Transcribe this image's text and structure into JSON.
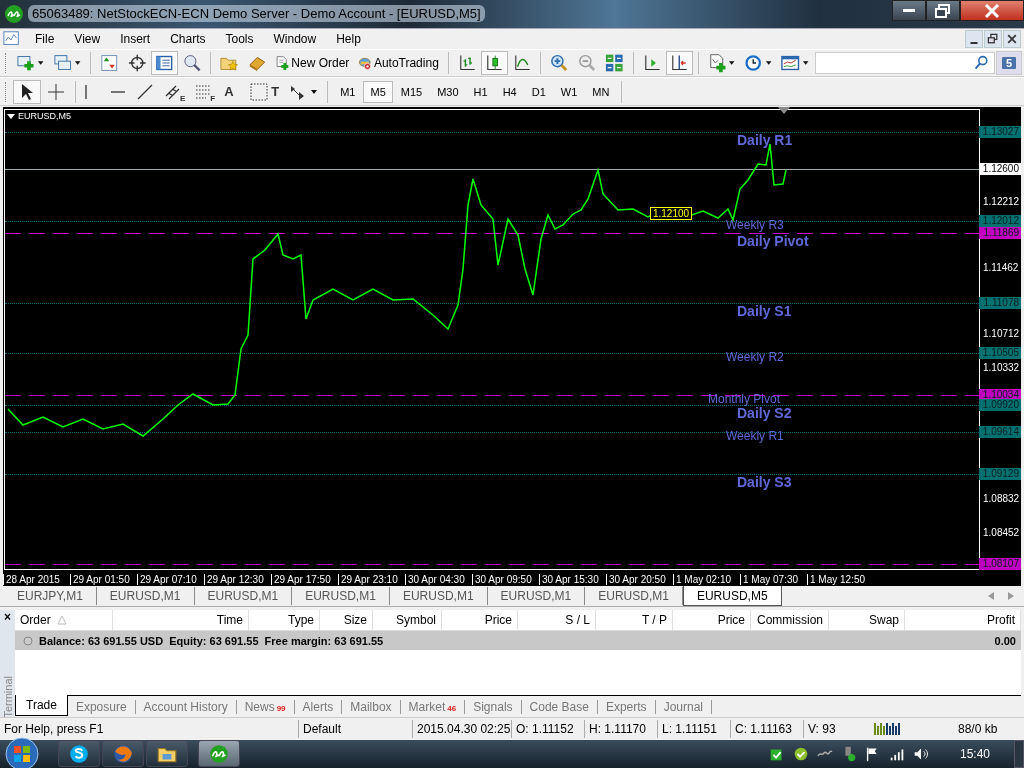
{
  "window": {
    "title": "65063489: NetStockECN-ECN Demo Server - Demo Account - [EURUSD,M5]"
  },
  "menu": [
    {
      "label": "File"
    },
    {
      "label": "View"
    },
    {
      "label": "Insert"
    },
    {
      "label": "Charts"
    },
    {
      "label": "Tools"
    },
    {
      "label": "Window"
    },
    {
      "label": "Help"
    }
  ],
  "toolbar": [
    {
      "kind": "new-chart",
      "dropdown": true,
      "on": false
    },
    {
      "kind": "profiles",
      "dropdown": true,
      "on": false
    },
    {
      "kind": "sep"
    },
    {
      "kind": "market-watch",
      "on": false
    },
    {
      "kind": "navigator",
      "on": false
    },
    {
      "kind": "data-window",
      "on": true
    },
    {
      "kind": "tester",
      "on": false
    },
    {
      "kind": "sep"
    },
    {
      "kind": "favorites",
      "on": false
    },
    {
      "kind": "ingot",
      "on": false
    },
    {
      "kind": "new-order",
      "label": "New Order",
      "on": false
    },
    {
      "kind": "autotrading",
      "label": "AutoTrading",
      "on": false
    },
    {
      "kind": "sep"
    },
    {
      "kind": "bar-chart",
      "on": false
    },
    {
      "kind": "candles",
      "on": true
    },
    {
      "kind": "line-chart",
      "on": false
    },
    {
      "kind": "sep"
    },
    {
      "kind": "zoom-in",
      "on": false
    },
    {
      "kind": "zoom-out",
      "on": false
    },
    {
      "kind": "tile",
      "on": false
    },
    {
      "kind": "sep"
    },
    {
      "kind": "chart-shift",
      "on": false
    },
    {
      "kind": "autoscroll",
      "on": true
    },
    {
      "kind": "sep"
    },
    {
      "kind": "indicators",
      "dropdown": true,
      "on": false
    },
    {
      "kind": "periods",
      "dropdown": true,
      "on": false
    },
    {
      "kind": "templates",
      "dropdown": true,
      "on": false
    }
  ],
  "search": {
    "badge": "5"
  },
  "tools": [
    {
      "kind": "cursor",
      "on": true
    },
    {
      "kind": "crosshair",
      "on": false
    },
    {
      "kind": "sep"
    },
    {
      "kind": "vline",
      "on": false
    },
    {
      "kind": "hline",
      "on": false
    },
    {
      "kind": "trendline",
      "on": false
    },
    {
      "kind": "channel",
      "glyph": "E",
      "on": false
    },
    {
      "kind": "fibo",
      "glyph": "F",
      "on": false
    },
    {
      "kind": "text",
      "glyph": "A",
      "on": false
    },
    {
      "kind": "label",
      "glyph": "T",
      "on": false
    },
    {
      "kind": "arrows",
      "dropdown": true,
      "on": false
    }
  ],
  "periods": [
    {
      "label": "M1",
      "selected": false
    },
    {
      "label": "M5",
      "selected": true
    },
    {
      "label": "M15",
      "selected": false
    },
    {
      "label": "M30",
      "selected": false
    },
    {
      "label": "H1",
      "selected": false
    },
    {
      "label": "H4",
      "selected": false
    },
    {
      "label": "D1",
      "selected": false
    },
    {
      "label": "W1",
      "selected": false
    },
    {
      "label": "MN",
      "selected": false
    }
  ],
  "chart": {
    "title": "EURUSD,M5",
    "current_price": "1.12600",
    "marker": "1.12100",
    "price_ticks": [
      "1.12212",
      "1.11462",
      "1.10712",
      "1.10332",
      "1.08832",
      "1.08452"
    ],
    "levels": [
      {
        "price": "1.13027",
        "kind": "level",
        "color": "#007070",
        "label": "Daily R1",
        "bold": true
      },
      {
        "price": "1.12012",
        "kind": "level",
        "color": "#007070",
        "label": "Weekly R3",
        "bold": false
      },
      {
        "price": "1.11869",
        "kind": "pivot",
        "color": "#c000c0",
        "label": "Daily Pivot",
        "bold": true
      },
      {
        "price": "1.11078",
        "kind": "level",
        "color": "#007070",
        "label": "Daily S1",
        "bold": true
      },
      {
        "price": "1.10505",
        "kind": "level",
        "color": "#007070",
        "label": "Weekly R2",
        "bold": false
      },
      {
        "price": "1.10034",
        "kind": "pivot",
        "color": "#c000c0",
        "label": "Monthly Pivot",
        "bold": false
      },
      {
        "price": "1.09920",
        "kind": "level",
        "color": "#007070",
        "label": "Daily S2",
        "bold": true
      },
      {
        "price": "1.09614",
        "kind": "level",
        "color": "#007070",
        "label": "Weekly R1",
        "bold": false
      },
      {
        "price": "1.09129",
        "kind": "level",
        "color": "#007070",
        "label": "Daily S3",
        "bold": true
      },
      {
        "price": "1.08107",
        "kind": "pivot",
        "color": "#c000c0"
      }
    ],
    "time_labels": [
      "28 Apr 2015",
      "29 Apr 01:50",
      "29 Apr 07:10",
      "29 Apr 12:30",
      "29 Apr 17:50",
      "29 Apr 23:10",
      "30 Apr 04:30",
      "30 Apr 09:50",
      "30 Apr 15:30",
      "30 Apr 20:50",
      "1 May 02:10",
      "1 May 07:30",
      "1 May 12:50"
    ]
  },
  "chart_tabs": [
    {
      "label": "EURJPY,M1",
      "selected": false
    },
    {
      "label": "EURUSD,M1",
      "selected": false
    },
    {
      "label": "EURUSD,M1",
      "selected": false
    },
    {
      "label": "EURUSD,M1",
      "selected": false
    },
    {
      "label": "EURUSD,M1",
      "selected": false
    },
    {
      "label": "EURUSD,M1",
      "selected": false
    },
    {
      "label": "EURUSD,M1",
      "selected": false
    },
    {
      "label": "EURUSD,M5",
      "selected": true
    }
  ],
  "terminal": {
    "close": "×",
    "title": "Terminal",
    "columns": [
      {
        "label": "Order"
      },
      {
        "label": "Time"
      },
      {
        "label": "Type"
      },
      {
        "label": "Size"
      },
      {
        "label": "Symbol"
      },
      {
        "label": "Price"
      },
      {
        "label": "S / L"
      },
      {
        "label": "T / P"
      },
      {
        "label": "Price"
      },
      {
        "label": "Commission"
      },
      {
        "label": "Swap"
      },
      {
        "label": "Profit"
      }
    ],
    "balance": "Balance: 63 691.55 USD  Equity: 63 691.55  Free margin: 63 691.55",
    "profit": "0.00",
    "tabs": [
      {
        "label": "Trade",
        "selected": true
      },
      {
        "label": "Exposure",
        "selected": false
      },
      {
        "label": "Account History",
        "selected": false
      },
      {
        "label": "News",
        "badge": "99",
        "selected": false
      },
      {
        "label": "Alerts",
        "selected": false
      },
      {
        "label": "Mailbox",
        "selected": false
      },
      {
        "label": "Market",
        "badge": "46",
        "selected": false
      },
      {
        "label": "Signals",
        "selected": false
      },
      {
        "label": "Code Base",
        "selected": false
      },
      {
        "label": "Experts",
        "selected": false
      },
      {
        "label": "Journal",
        "selected": false
      }
    ]
  },
  "status_bar": [
    "For Help, press F1",
    "Default",
    "2015.04.30 02:25",
    "O: 1.11152",
    "H: 1.11170",
    "L: 1.11151",
    "C: 1.11163",
    "V: 93",
    "88/0 kb"
  ],
  "taskbar": {
    "apps": [
      {
        "kind": "skype",
        "selected": false
      },
      {
        "kind": "browser",
        "selected": false
      },
      {
        "kind": "folder",
        "selected": false
      },
      {
        "kind": "terminal",
        "selected": true
      }
    ],
    "clock": "15:40"
  }
}
